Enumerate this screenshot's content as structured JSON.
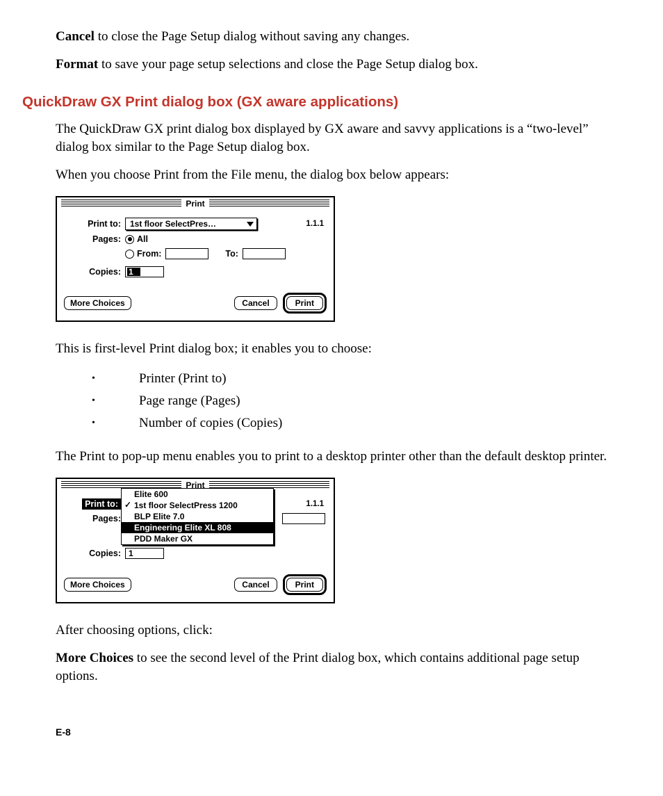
{
  "intro": {
    "cancel_bold": "Cancel",
    "cancel_rest": " to close the Page Setup dialog without saving any changes.",
    "format_bold": "Format",
    "format_rest": " to save your page setup selections and close the Page Setup dialog box."
  },
  "heading": "QuickDraw GX Print dialog box (GX aware applications)",
  "para1": "The QuickDraw GX print dialog box displayed by GX aware and savvy applications is a “two-level” dialog box similar to the Page Setup dialog box.",
  "para2": "When you choose Print from the File menu, the dialog box below appears:",
  "dialog1": {
    "title": "Print",
    "version": "1.1.1",
    "print_to_label": "Print to:",
    "print_to_value": "1st floor SelectPres…",
    "pages_label": "Pages:",
    "radio_all": "All",
    "radio_from": "From:",
    "to_label": "To:",
    "copies_label": "Copies:",
    "copies_value": "1",
    "more": "More Choices",
    "cancel": "Cancel",
    "print": "Print"
  },
  "para3": "This is first-level Print dialog box; it enables you to choose:",
  "bullets": [
    "Printer (Print to)",
    "Page range (Pages)",
    "Number of copies (Copies)"
  ],
  "para4": "The Print to pop-up menu enables you to print to a desktop printer other than the default desktop printer.",
  "dialog2": {
    "title": "Print",
    "version": "1.1.1",
    "print_to_label": "Print to:",
    "pages_label": "Pages:",
    "copies_label": "Copies:",
    "copies_value": "1",
    "more": "More Choices",
    "cancel": "Cancel",
    "print": "Print",
    "menu": [
      "Elite 600",
      "1st floor SelectPress 1200",
      "BLP Elite 7.0",
      "Engineering Elite XL 808",
      "PDD Maker GX"
    ]
  },
  "para5": "After choosing options, click:",
  "more_bold": "More Choices",
  "more_rest": " to see the second level of the Print dialog box, which  contains additional page setup options.",
  "page_number": "E-8"
}
